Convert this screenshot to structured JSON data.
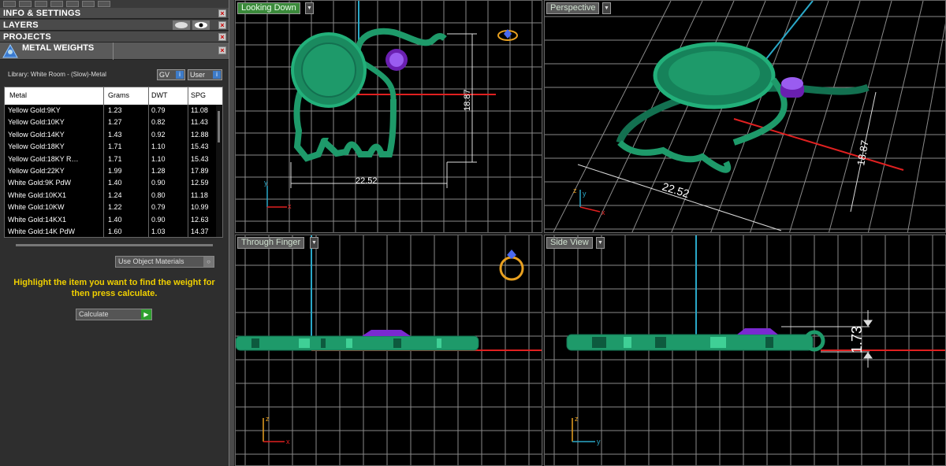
{
  "panels": {
    "info_settings": "INFO & SETTINGS",
    "layers": "LAYERS",
    "projects": "PROJECTS",
    "metal_weights": "METAL WEIGHTS"
  },
  "library": {
    "label": "Library: White Room - (Slow)-Metal",
    "gv": "GV",
    "user": "User"
  },
  "table": {
    "headers": [
      "Metal",
      "Grams",
      "DWT",
      "SPG"
    ],
    "rows": [
      [
        "Yellow Gold:9KY",
        "1.23",
        "0.79",
        "11.08"
      ],
      [
        "Yellow Gold:10KY",
        "1.27",
        "0.82",
        "11.43"
      ],
      [
        "Yellow Gold:14KY",
        "1.43",
        "0.92",
        "12.88"
      ],
      [
        "Yellow Gold:18KY",
        "1.71",
        "1.10",
        "15.43"
      ],
      [
        "Yellow Gold:18KY R…",
        "1.71",
        "1.10",
        "15.43"
      ],
      [
        "Yellow Gold:22KY",
        "1.99",
        "1.28",
        "17.89"
      ],
      [
        "White Gold:9K PdW",
        "1.40",
        "0.90",
        "12.59"
      ],
      [
        "White Gold:10KX1",
        "1.24",
        "0.80",
        "11.18"
      ],
      [
        "White Gold:10KW",
        "1.22",
        "0.79",
        "10.99"
      ],
      [
        "White Gold:14KX1",
        "1.40",
        "0.90",
        "12.63"
      ],
      [
        "White Gold:14K PdW",
        "1.60",
        "1.03",
        "14.37"
      ]
    ]
  },
  "use_object_materials": "Use Object Materials",
  "hint": "Highlight the item you want to find the weight for then press calculate.",
  "calculate": "Calculate",
  "viewports": {
    "looking_down": "Looking Down",
    "perspective": "Perspective",
    "through_finger": "Through Finger",
    "side_view": "Side View"
  },
  "dimensions": {
    "width": "22.52",
    "height": "18.87",
    "thickness": "1.73"
  },
  "colors": {
    "model": "#1e9a6a",
    "gem": "#8a2be2",
    "grid": "#8a8a8a",
    "axis_x": "#ff2020",
    "axis_y": "#2aa8c8",
    "hint": "#f0d000"
  }
}
